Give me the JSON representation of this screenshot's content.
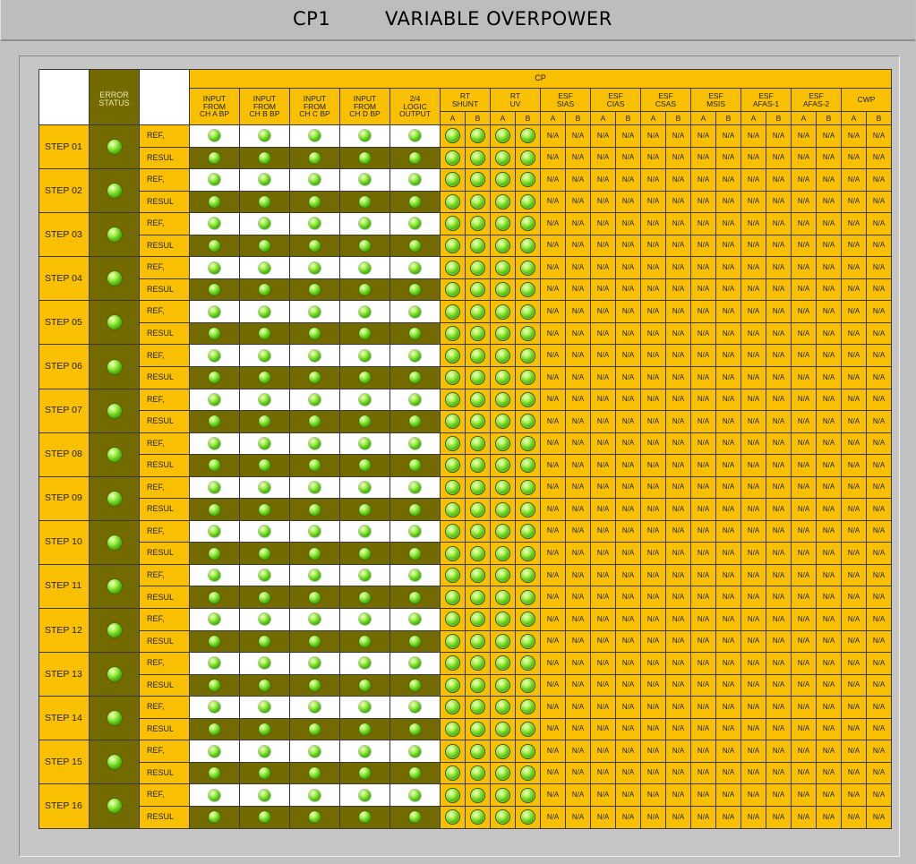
{
  "title": {
    "left": "CP1",
    "right": "VARIABLE OVERPOWER"
  },
  "header": {
    "error_status": "ERROR\nSTATUS",
    "cp": "CP",
    "inputs": [
      "INPUT\nFROM\nCH A BP",
      "INPUT\nFROM\nCH B BP",
      "INPUT\nFROM\nCH C BP",
      "INPUT\nFROM\nCH D BP",
      "2/4\nLOGIC\nOUTPUT"
    ],
    "groups": [
      "RT\nSHUNT",
      "RT\nUV",
      "ESF\nSIAS",
      "ESF\nCIAS",
      "ESF\nCSAS",
      "ESF\nMSIS",
      "ESF\nAFAS-1",
      "ESF\nAFAS-2",
      "CWP"
    ],
    "a": "A",
    "b": "B"
  },
  "row_labels": {
    "ref": "REF,",
    "result": "RESUL"
  },
  "na": "N/A",
  "steps": [
    "STEP 01",
    "STEP 02",
    "STEP 03",
    "STEP 04",
    "STEP 05",
    "STEP 06",
    "STEP 07",
    "STEP 08",
    "STEP 09",
    "STEP 10",
    "STEP 11",
    "STEP 12",
    "STEP 13",
    "STEP 14",
    "STEP 15",
    "STEP 16"
  ],
  "colors": {
    "accent_yellow": "#f9c002",
    "olive": "#746b00",
    "led_green": "#4fbd0e",
    "background": "#c2c2c2"
  },
  "icons": {
    "indicator": "green-led-indicator-icon"
  }
}
